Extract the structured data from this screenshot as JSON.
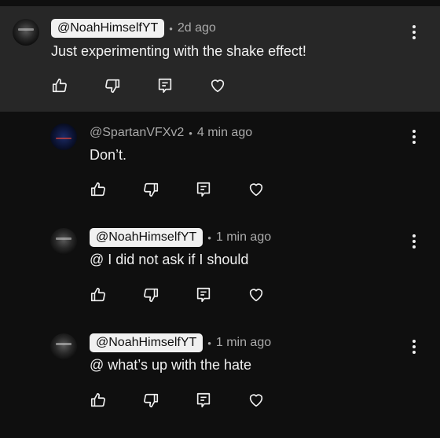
{
  "comments": [
    {
      "handle": "@NoahHimselfYT",
      "handle_style": "pill",
      "time": "2d ago",
      "text": "Just experimenting with the shake effect!",
      "highlighted": true
    },
    {
      "handle": "@SpartanVFXv2",
      "handle_style": "plain",
      "time": "4 min ago",
      "text": "Don’t."
    },
    {
      "handle": "@NoahHimselfYT",
      "handle_style": "pill",
      "time": "1 min ago",
      "text": "@  I did not ask if I should"
    },
    {
      "handle": "@NoahHimselfYT",
      "handle_style": "pill",
      "time": "1 min ago",
      "text": "@  what’s up with the hate"
    }
  ],
  "separator": "•",
  "icons": [
    "thumbs-up-icon",
    "thumbs-down-icon",
    "reply-icon",
    "heart-icon",
    "more-vert-icon"
  ],
  "colors": {
    "background": "#0f0f0f",
    "highlight": "#272727",
    "pill": "#f1f1f1",
    "muted": "#aaaaaa"
  }
}
